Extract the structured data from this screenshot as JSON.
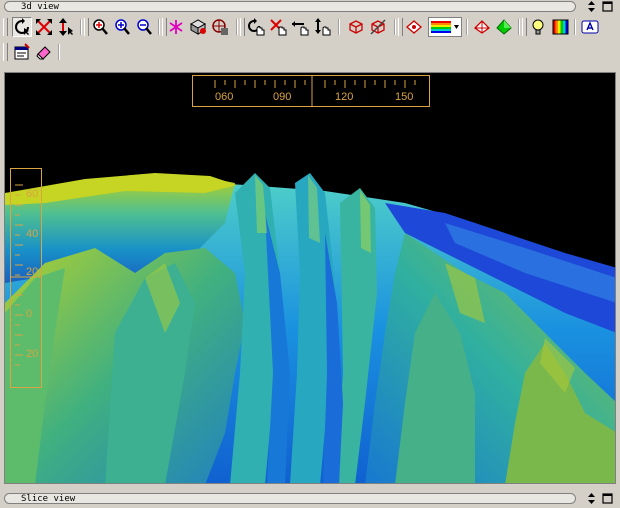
{
  "top_panel": {
    "title": "3d view",
    "collapse_icon": "up-down-arrows-icon",
    "maximize_icon": "maximize-icon"
  },
  "bottom_panel": {
    "title": "Slice view",
    "collapse_icon": "up-down-arrows-icon",
    "maximize_icon": "maximize-icon"
  },
  "toolbar1": [
    {
      "name": "rotate-tool-icon",
      "pressed": true
    },
    {
      "name": "zoom-xy-tool-icon"
    },
    {
      "name": "zoom-z-tool-icon"
    },
    {
      "name": "zoom-all-icon"
    },
    {
      "name": "zoom-in-icon"
    },
    {
      "name": "zoom-out-icon"
    },
    {
      "name": "pick-point-icon"
    },
    {
      "name": "light-icon"
    },
    {
      "name": "render-mode-icon"
    },
    {
      "name": "rotate-hand-icon"
    },
    {
      "name": "pan-hand-icon"
    },
    {
      "name": "horizontal-hand-icon"
    },
    {
      "name": "vertical-hand-icon"
    },
    {
      "name": "wireframe-icon"
    },
    {
      "name": "hide-surface-icon"
    },
    {
      "name": "color-surface-icon"
    },
    {
      "name": "colormap-dropdown-icon"
    },
    {
      "name": "shade-off-icon"
    },
    {
      "name": "shade-on-icon"
    },
    {
      "name": "lightbulb-icon"
    },
    {
      "name": "color-bar-icon"
    },
    {
      "name": "text-label-icon"
    }
  ],
  "toolbar2": [
    {
      "name": "properties-icon"
    },
    {
      "name": "eraser-icon"
    }
  ],
  "compass": {
    "ticks": [
      "060",
      "090",
      "120",
      "150"
    ]
  },
  "depth_scale": {
    "ticks": [
      "60",
      "40",
      "20",
      "0",
      "20"
    ]
  },
  "colors": {
    "frame_accent": "#d9a441"
  }
}
